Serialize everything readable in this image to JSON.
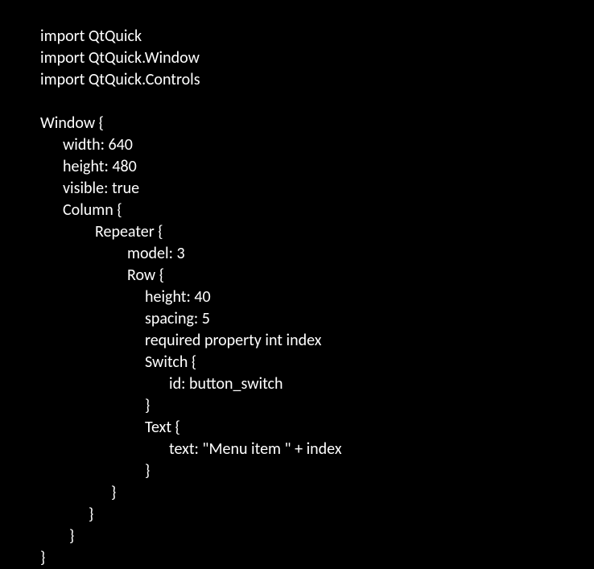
{
  "code": {
    "line1": "import QtQuick",
    "line2": "import QtQuick.Window",
    "line3": "import QtQuick.Controls",
    "line4": "Window {",
    "line5": "width: 640",
    "line6": "height: 480",
    "line7": "visible: true",
    "line8": "Column {",
    "line9": "Repeater {",
    "line10": "model: 3",
    "line11": "Row {",
    "line12": "height: 40",
    "line13": "spacing: 5",
    "line14": "required property int index",
    "line15": "Switch {",
    "line16": "id: button_switch",
    "line17": "}",
    "line18": "Text {",
    "line19": "text: \"Menu item \" + index",
    "line20": "}",
    "line21": "}",
    "line22": "}",
    "line23": "}",
    "line24": "}"
  }
}
